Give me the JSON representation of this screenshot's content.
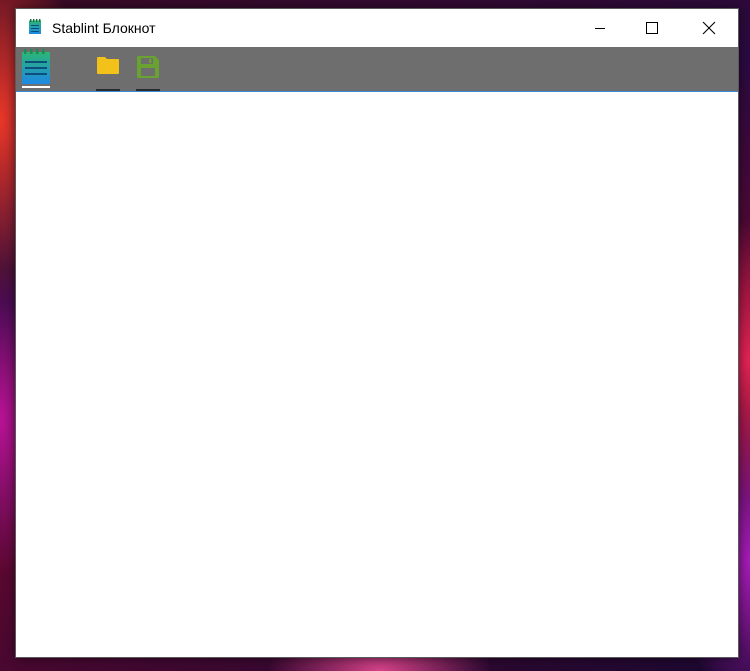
{
  "window": {
    "title": "Stablint Блокнот"
  },
  "titlebar_buttons": {
    "minimize": "minimize-icon",
    "maximize": "maximize-icon",
    "close": "close-icon"
  },
  "toolbar": {
    "logo_icon": "notepad-logo-icon",
    "open_icon": "folder-icon",
    "save_icon": "floppy-disk-icon"
  },
  "editor": {
    "value": ""
  },
  "colors": {
    "toolbar_bg": "#6e6e6e",
    "toolbar_border": "#3a8ad6",
    "folder": "#f2c21a",
    "floppy": "#6aa232",
    "logo_top": "#2bb673",
    "logo_bottom": "#1e88e5"
  }
}
